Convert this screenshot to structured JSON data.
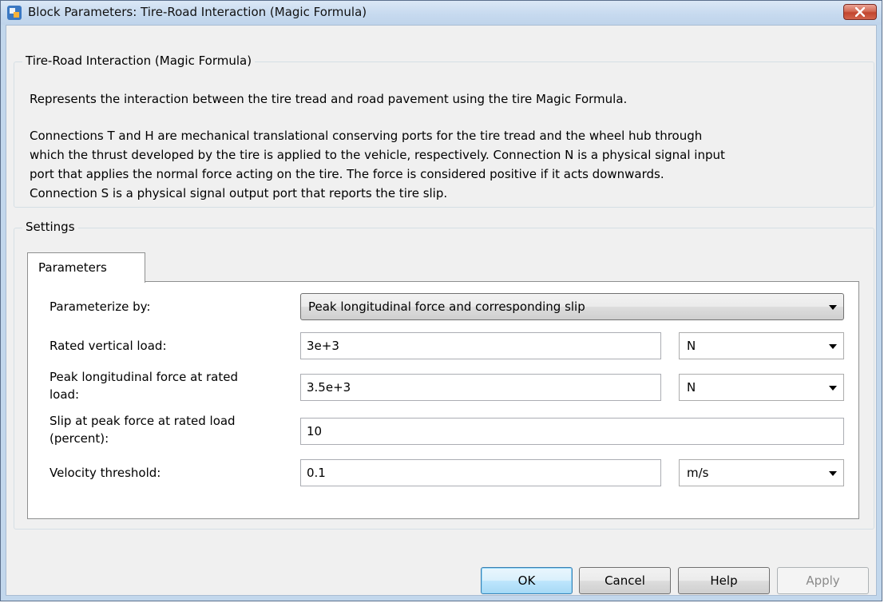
{
  "window": {
    "title": "Block Parameters: Tire-Road Interaction (Magic Formula)",
    "icon": "simulink-block-icon",
    "close_icon": "close-icon"
  },
  "description": {
    "group_title": "Tire-Road Interaction (Magic Formula)",
    "paragraph1": "Represents the interaction between the tire tread and road pavement using the tire Magic Formula.",
    "paragraph2_lines": [
      "Connections T and H are mechanical translational conserving ports for the tire tread and the wheel hub through",
      "which the thrust developed by the tire is applied to the vehicle, respectively. Connection N is a physical signal input",
      "port that applies the normal force acting on the tire. The force is considered positive if it acts downwards.",
      "Connection S is a physical signal output port that reports the tire slip."
    ]
  },
  "settings": {
    "group_title": "Settings",
    "tab_label": "Parameters",
    "params": [
      {
        "label_lines": [
          "Parameterize by:"
        ],
        "value": "Peak longitudinal force and corresponding slip",
        "kind": "select"
      },
      {
        "label_lines": [
          "Rated vertical load:"
        ],
        "value": "3e+3",
        "unit": "N",
        "kind": "field-unit"
      },
      {
        "label_lines": [
          "Peak longitudinal force at rated",
          "load:"
        ],
        "value": "3.5e+3",
        "unit": "N",
        "kind": "field-unit"
      },
      {
        "label_lines": [
          "Slip at peak force at rated load",
          "(percent):"
        ],
        "value": "10",
        "kind": "field"
      },
      {
        "label_lines": [
          "Velocity threshold:"
        ],
        "value": "0.1",
        "unit": "m/s",
        "kind": "field-unit"
      }
    ]
  },
  "buttons": {
    "ok": "OK",
    "cancel": "Cancel",
    "help": "Help",
    "apply": "Apply"
  },
  "colors": {
    "titlebar": "#c7daef",
    "close_button": "#c2452e",
    "default_button_border": "#3c7fb1"
  }
}
